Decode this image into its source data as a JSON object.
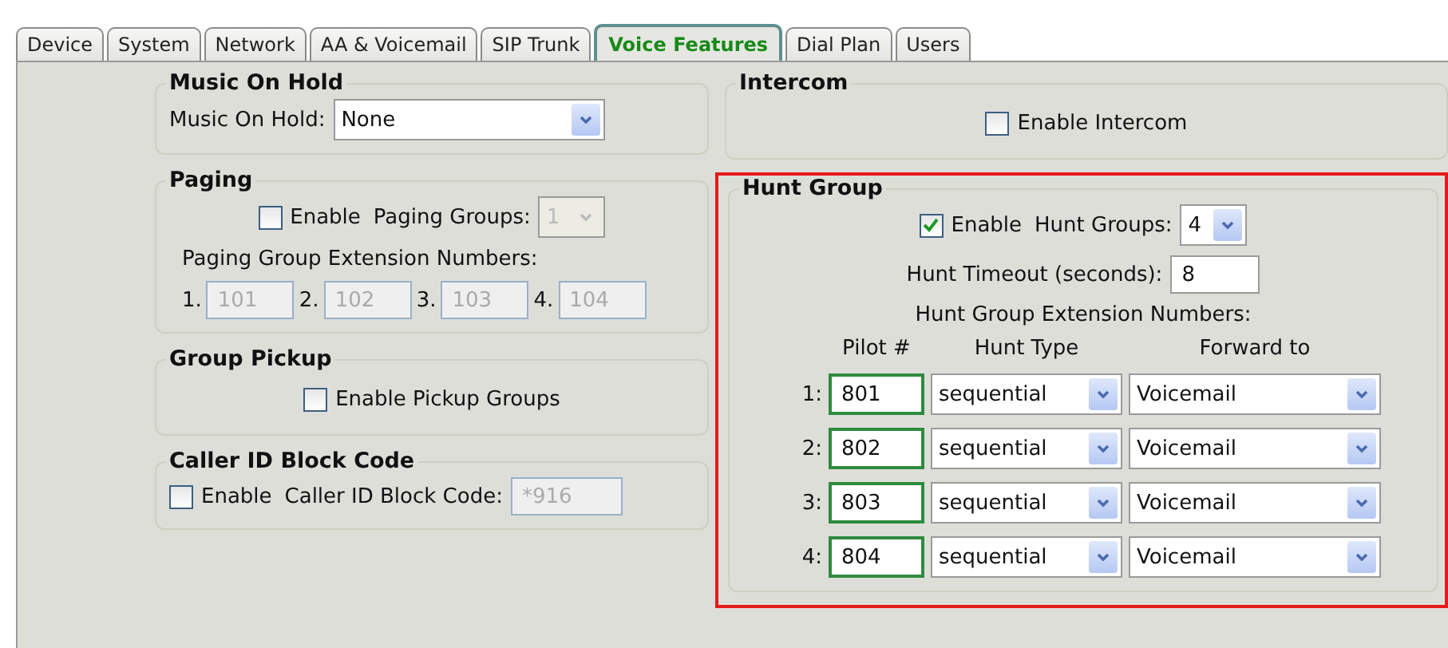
{
  "tabs": [
    {
      "label": "Device",
      "selected": false
    },
    {
      "label": "System",
      "selected": false
    },
    {
      "label": "Network",
      "selected": false
    },
    {
      "label": "AA & Voicemail",
      "selected": false
    },
    {
      "label": "SIP Trunk",
      "selected": false
    },
    {
      "label": "Voice Features",
      "selected": true
    },
    {
      "label": "Dial Plan",
      "selected": false
    },
    {
      "label": "Users",
      "selected": false
    }
  ],
  "music_on_hold": {
    "title": "Music On Hold",
    "label": "Music On Hold:",
    "value": "None"
  },
  "paging": {
    "title": "Paging",
    "enable": {
      "label": "Enable",
      "checked": false
    },
    "groups_label": "Paging Groups:",
    "groups_value": "1",
    "disabled": true,
    "numbers_label": "Paging Group Extension Numbers:",
    "numbers": [
      {
        "index": "1.",
        "value": "101"
      },
      {
        "index": "2.",
        "value": "102"
      },
      {
        "index": "3.",
        "value": "103"
      },
      {
        "index": "4.",
        "value": "104"
      }
    ]
  },
  "group_pickup": {
    "title": "Group Pickup",
    "enable": {
      "label": "Enable Pickup Groups",
      "checked": false
    }
  },
  "caller_id_block": {
    "title": "Caller ID Block Code",
    "enable": {
      "label": "Enable",
      "checked": false
    },
    "code_label": "Caller ID Block Code:",
    "code_value": "*916",
    "disabled": true
  },
  "intercom": {
    "title": "Intercom",
    "enable": {
      "label": "Enable Intercom",
      "checked": false
    }
  },
  "hunt_group": {
    "title": "Hunt Group",
    "highlighted": true,
    "enable": {
      "label": "Enable",
      "checked": true
    },
    "groups_label": "Hunt Groups:",
    "groups_value": "4",
    "timeout_label": "Hunt Timeout (seconds):",
    "timeout_value": "8",
    "numbers_label": "Hunt Group Extension Numbers:",
    "columns": [
      "Pilot #",
      "Hunt Type",
      "Forward to"
    ],
    "rows": [
      {
        "index": "1:",
        "pilot": "801",
        "hunt_type": "sequential",
        "forward_to": "Voicemail"
      },
      {
        "index": "2:",
        "pilot": "802",
        "hunt_type": "sequential",
        "forward_to": "Voicemail"
      },
      {
        "index": "3:",
        "pilot": "803",
        "hunt_type": "sequential",
        "forward_to": "Voicemail"
      },
      {
        "index": "4:",
        "pilot": "804",
        "hunt_type": "sequential",
        "forward_to": "Voicemail"
      }
    ]
  }
}
